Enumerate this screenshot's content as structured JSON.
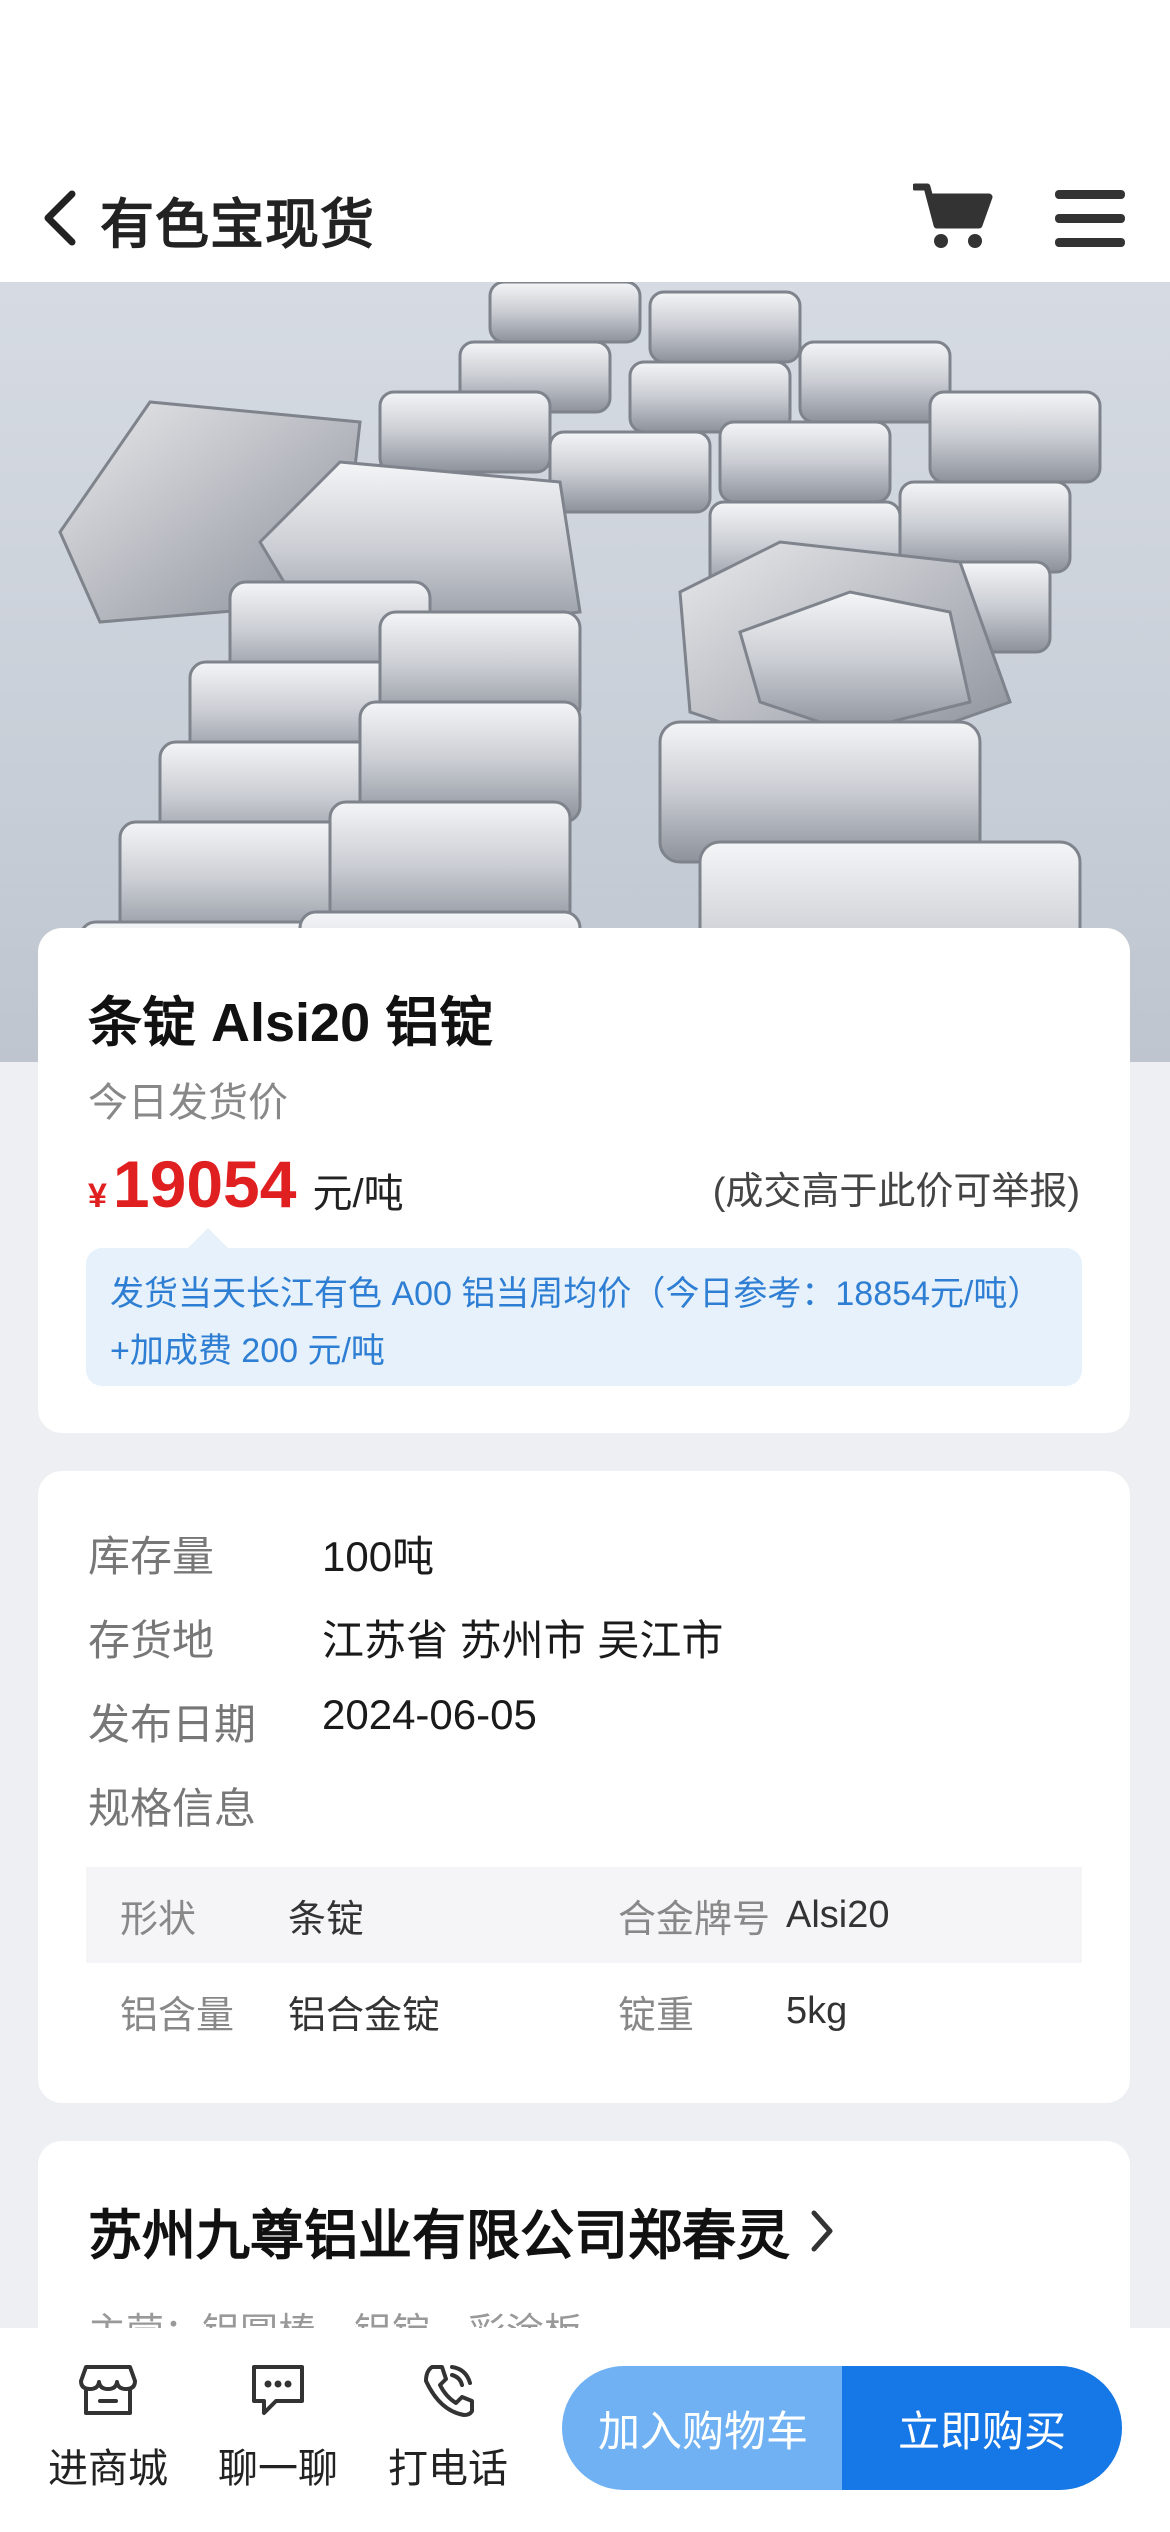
{
  "nav": {
    "title": "有色宝现货"
  },
  "product": {
    "title": "条锭 Alsi20 铝锭",
    "price_label": "今日发货价",
    "price_symbol": "¥",
    "price": "19054",
    "price_unit": "元/吨",
    "report_note": "(成交高于此价可举报)",
    "tip": "发货当天长江有色 A00 铝当周均价（今日参考：18854元/吨）+加成费 200 元/吨"
  },
  "info": {
    "rows": [
      {
        "label": "库存量",
        "value": "100吨"
      },
      {
        "label": "存货地",
        "value": "江苏省 苏州市 吴江市"
      },
      {
        "label": "发布日期",
        "value": "2024-06-05"
      },
      {
        "label": "规格信息",
        "value": ""
      }
    ],
    "specs": [
      {
        "label1": "形状",
        "value1": "条锭",
        "label2": "合金牌号",
        "value2": "Alsi20"
      },
      {
        "label1": "铝含量",
        "value1": "铝合金锭",
        "label2": "锭重",
        "value2": "5kg"
      }
    ]
  },
  "shop": {
    "name": "苏州九尊铝业有限公司郑春灵",
    "main": "主营：铝圆棒、铝锭、彩涂板"
  },
  "bottom": {
    "tabs": [
      {
        "label": "进商城",
        "icon": "store-icon"
      },
      {
        "label": "聊一聊",
        "icon": "chat-icon"
      },
      {
        "label": "打电话",
        "icon": "phone-icon"
      }
    ],
    "add_cart": "加入购物车",
    "buy_now": "立即购买"
  },
  "colors": {
    "price_red": "#e02020",
    "tip_blue": "#2e7ed3",
    "cart_button": "#6fb1f3",
    "buy_button": "#1677e6"
  }
}
